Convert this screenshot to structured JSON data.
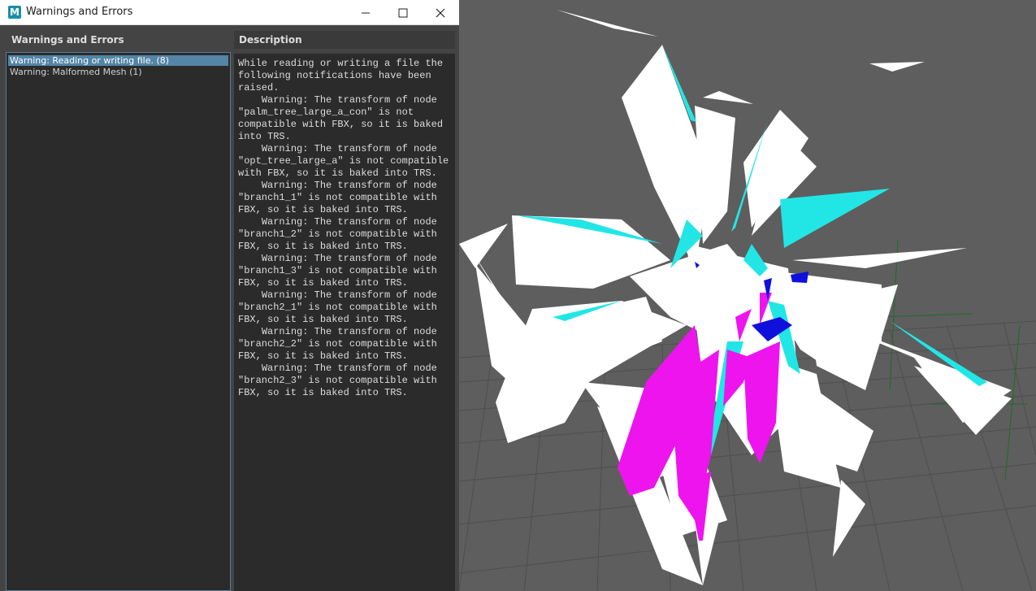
{
  "window": {
    "title": "Warnings and Errors",
    "app_icon_letter": "M",
    "icons": {
      "app": "maya-icon",
      "minimize": "minimize-icon",
      "maximize": "maximize-icon",
      "close": "close-icon"
    }
  },
  "left_panel": {
    "header": "Warnings and Errors",
    "items": [
      {
        "label": "Warning: Reading or writing file. (8)",
        "selected": true
      },
      {
        "label": "Warning: Malformed Mesh (1)",
        "selected": false
      }
    ]
  },
  "right_panel": {
    "header": "Description",
    "text": "While reading or writing a file the\nfollowing notifications have been\nraised.\n    Warning: The transform of node\n\"palm_tree_large_a_con\" is not\ncompatible with FBX, so it is baked\ninto TRS.\n    Warning: The transform of node\n\"opt_tree_large_a\" is not compatible\nwith FBX, so it is baked into TRS.\n    Warning: The transform of node\n\"branch1_1\" is not compatible with\nFBX, so it is baked into TRS.\n    Warning: The transform of node\n\"branch1_2\" is not compatible with\nFBX, so it is baked into TRS.\n    Warning: The transform of node\n\"branch1_3\" is not compatible with\nFBX, so it is baked into TRS.\n    Warning: The transform of node\n\"branch2_1\" is not compatible with\nFBX, so it is baked into TRS.\n    Warning: The transform of node\n\"branch2_2\" is not compatible with\nFBX, so it is baked into TRS.\n    Warning: The transform of node\n\"branch2_3\" is not compatible with\nFBX, so it is baked into TRS."
  },
  "colors": {
    "selection": "#5285a6",
    "viewport_bg": "#5e5e5e",
    "mesh_white": "#ffffff",
    "mesh_cyan": "#22e6e6",
    "mesh_magenta": "#ee14ee",
    "mesh_blue": "#1010dd"
  }
}
